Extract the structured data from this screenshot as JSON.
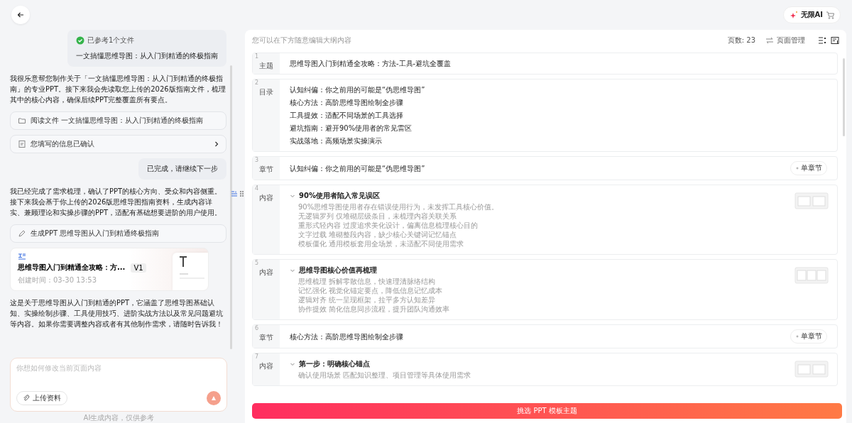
{
  "header": {
    "upgrade_label": "无限AI"
  },
  "chat": {
    "messages": [
      {
        "kind": "user_files",
        "status": "已参考1个文件",
        "file": "一文搞懂思维导图：从入门到精通的终极指南"
      },
      {
        "kind": "ai_text",
        "text": "我很乐意帮您制作关于「一文搞懂思维导图：从入门到精通的终极指南」的专业PPT。接下来我会先读取您上传的2026版指南文件，梳理其中的核心内容，确保后续PPT完整覆盖所有要点。"
      },
      {
        "kind": "file_action",
        "label": "阅读文件 一文搞懂思维导图：从入门到精通的终极指南",
        "chevron": false
      },
      {
        "kind": "form_action",
        "label": "您填写的信息已确认",
        "chevron": true
      },
      {
        "kind": "user_text",
        "text": "已完成，请继续下一步"
      },
      {
        "kind": "ai_text",
        "text": "我已经完成了需求梳理，确认了PPT的核心方向、受众和内容侧重。接下来我会基于你上传的2026版思维导图指南资料，生成内容详实、兼顾理论和实操步骤的PPT，适配有基础想要进阶的用户使用。"
      },
      {
        "kind": "generate_action",
        "label": "生成PPT 思维导图从入门到精通终极指南",
        "chevron": false
      },
      {
        "kind": "doc_card",
        "title": "思维导图入门到精通全攻略：方...",
        "version": "V1",
        "created": "创建时间：03-30 13:53"
      },
      {
        "kind": "ai_text",
        "text": "这是关于思维导图从入门到精通的PPT，它涵盖了思维导图基础认知、实操绘制步骤、工具使用技巧、进阶实战方法以及常见问题避坑等内容。如果你需要调整内容或者有其他制作需求，请随时告诉我！"
      }
    ]
  },
  "composer": {
    "placeholder": "你想如何修改当前页面内容",
    "upload_label": "上传资料"
  },
  "disclaimer": "AI生成内容，仅供参考",
  "outline": {
    "hint": "您可以在下方随意编辑大纲内容",
    "page_count": "页数: 23",
    "manage_label": "页面管理",
    "items": [
      {
        "kind": "title",
        "number": "1",
        "label": "主题",
        "text": "思维导图入门到精通全攻略：方法-工具-避坑全覆盖"
      },
      {
        "kind": "toc",
        "number": "2",
        "label": "目录",
        "lines": [
          "认知纠偏：你之前用的可能是“伪思维导图”",
          "核心方法：高阶思维导图绘制全步骤",
          "工具提效：适配不同场景的工具选择",
          "避坑指南：避开90%使用者的常见雷区",
          "实战落地：高频场景实操演示"
        ]
      },
      {
        "kind": "chapter",
        "number": "3",
        "label": "章节",
        "text": "认知纠偏：你之前用的可能是“伪思维导图”",
        "button": "单章节"
      },
      {
        "kind": "content",
        "number": "4",
        "label": "内容",
        "expanded": true,
        "heading": "90%使用者陷入常见误区",
        "lines": [
          "90%思维导图使用者存在错误使用行为，未发挥工具核心价值。",
          "无逻辑罗列 仅堆砌层级条目，未梳理内容关联关系",
          "重形式轻内容 过度追求美化设计，偏离信息梳理核心目的",
          "文字过载 堆砌整段内容，缺少核心关键词记忆锚点",
          "模板僵化 通用模板套用全场景，未适配不同使用需求"
        ]
      },
      {
        "kind": "content",
        "number": "5",
        "label": "内容",
        "expanded": true,
        "heading": "思维导图核心价值再梳理",
        "lines": [
          "思维梳理 拆解零散信息，快速理清脉络结构",
          "记忆强化 视觉化锚定要点，降低信息记忆成本",
          "逻辑对齐 统一呈现框架，拉平多方认知差异",
          "协作提效 简化信息同步流程，提升团队沟通效率"
        ]
      },
      {
        "kind": "chapter",
        "number": "6",
        "label": "章节",
        "text": "核心方法：高阶思维导图绘制全步骤",
        "button": "单章节"
      },
      {
        "kind": "content",
        "number": "7",
        "label": "内容",
        "expanded": true,
        "heading": "第一步：明确核心锚点",
        "lines": [
          "确认使用场景 匹配知识整理、项目管理等具体使用需求"
        ]
      }
    ],
    "cta": "挑选 PPT 模板主题"
  }
}
